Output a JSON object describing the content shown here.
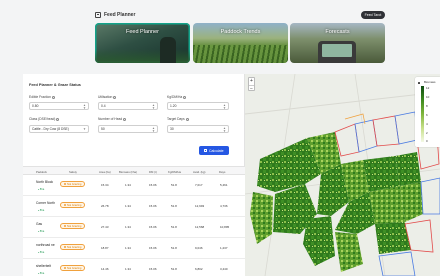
{
  "header": {
    "title": "Feed Planner",
    "button_label": "Feed Tarot"
  },
  "tiles": [
    {
      "label": "Feed Planner",
      "active": true
    },
    {
      "label": "Paddock Trends",
      "active": false
    },
    {
      "label": "Forecasts",
      "active": false
    }
  ],
  "form": {
    "title": "Feed Planner & Graze Status",
    "edible_fraction_label": "Edible Fraction",
    "edible_fraction_value": "0.80",
    "utilisation_label": "Utilisation",
    "utilisation_value": "0.4",
    "kg_dm_ha_label": "Kg/DM/Ha",
    "kg_dm_ha_value": "1.20",
    "class_label": "Class (DSE/head)",
    "class_value": "Cattle - Dry Cow (8 DSE)",
    "number_of_head_label": "Number of Head",
    "number_of_head_value": "50",
    "target_days_label": "Target Days",
    "target_days_value": "30",
    "calculate_label": "Calculate"
  },
  "table": {
    "headers": [
      "Paddock",
      "Safety",
      "Area (ha)",
      "Biomass (t/ha)",
      "DM (t)",
      "Kg/DM/Ha",
      "Avail. (kg)",
      "Days"
    ],
    "rows": [
      {
        "name": "North Block",
        "sub": "8ha",
        "status": "Not Grazing",
        "area": "15.34",
        "biomass": "1.34",
        "dm": "15.06",
        "kgdm": "51.8",
        "avail": "7,017",
        "days": "5,461"
      },
      {
        "name": "Corner North",
        "sub": "8ha",
        "status": "Not Grazing",
        "area": "26.78",
        "biomass": "1.34",
        "dm": "15.06",
        "kgdm": "51.8",
        "avail": "12,993",
        "days": "4,736"
      },
      {
        "name": "Gas",
        "sub": "8ha",
        "status": "Not Grazing",
        "area": "27.43",
        "biomass": "1.34",
        "dm": "15.06",
        "kgdm": "51.8",
        "avail": "12,568",
        "days": "10,895"
      },
      {
        "name": "northroad ne",
        "sub": "8ha",
        "status": "Not Grazing",
        "area": "18.87",
        "biomass": "1.34",
        "dm": "15.06",
        "kgdm": "51.8",
        "avail": "9,046",
        "days": "1,237"
      },
      {
        "name": "shellerbelt",
        "sub": "8ha",
        "status": "Not Grazing",
        "area": "14.46",
        "biomass": "1.34",
        "dm": "15.06",
        "kgdm": "51.8",
        "avail": "6,802",
        "days": "3,440"
      }
    ]
  },
  "map": {
    "zoom_in": "+",
    "zoom_out": "−",
    "legend_title": "Biomass",
    "legend_ticks": [
      "12",
      "10",
      "8",
      "6",
      "4",
      "2",
      "0"
    ]
  },
  "colors": {
    "accent_blue": "#2557e3",
    "status_orange": "#f0a13d",
    "pasture_dark": "#2f7a1d",
    "pasture_light": "#a9d35e"
  }
}
